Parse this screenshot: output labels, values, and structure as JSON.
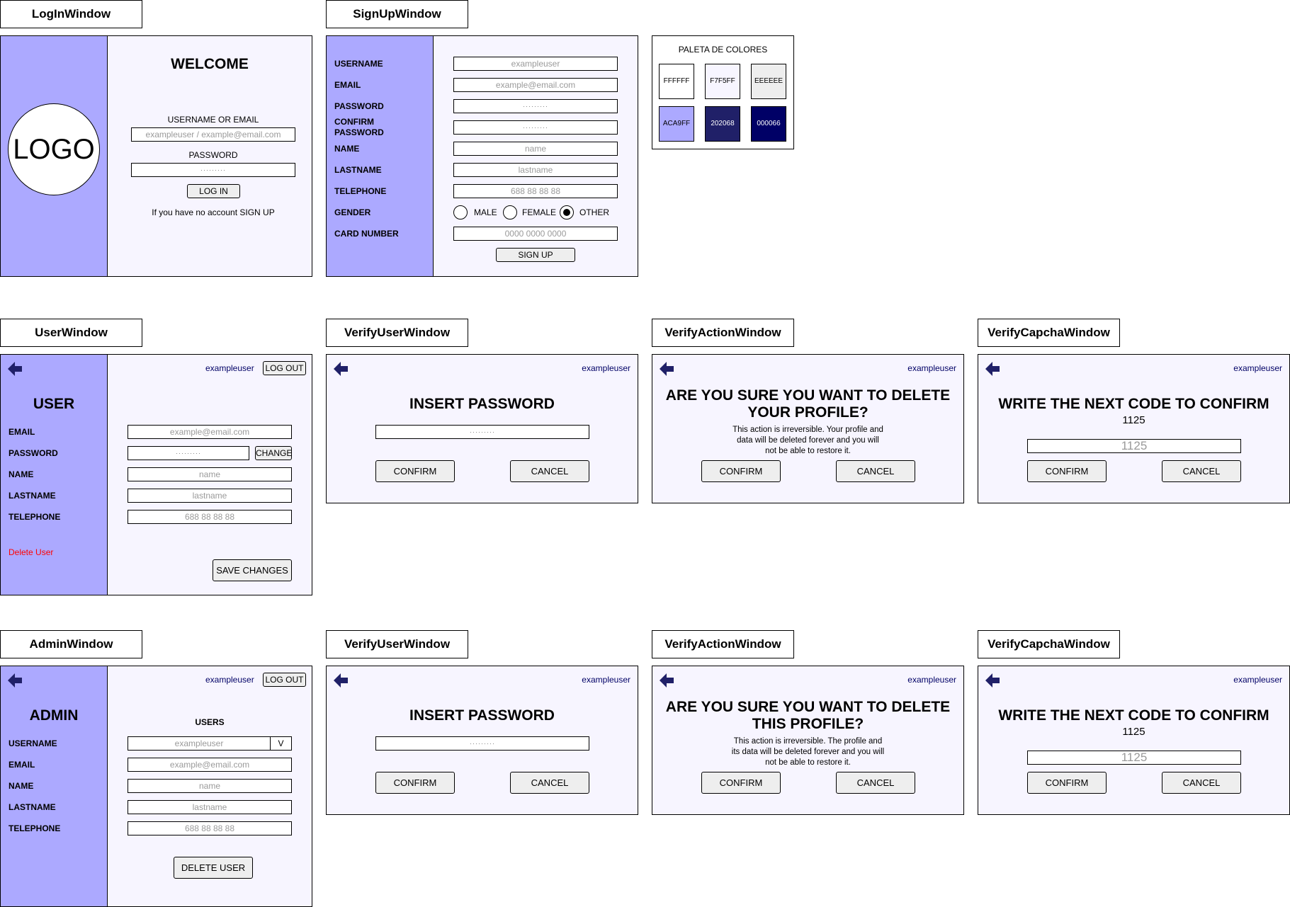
{
  "login": {
    "title": "LogInWindow",
    "logo": "LOGO",
    "heading": "WELCOME",
    "user_label": "USERNAME OR EMAIL",
    "user_placeholder": "exampleuser / example@email.com",
    "pass_label": "PASSWORD",
    "pass_mask": "·········",
    "button": "LOG IN",
    "signup_text": "If you have no account SIGN UP"
  },
  "signup": {
    "title": "SignUpWindow",
    "fields": [
      {
        "label": "USERNAME",
        "value": "exampleuser"
      },
      {
        "label": "EMAIL",
        "value": "example@email.com"
      },
      {
        "label": "PASSWORD",
        "value": "·········"
      },
      {
        "label": "CONFIRM\nPASSWORD",
        "value": "·········"
      },
      {
        "label": "NAME",
        "value": "name"
      },
      {
        "label": "LASTNAME",
        "value": "lastname"
      },
      {
        "label": "TELEPHONE",
        "value": "688 88 88 88"
      },
      {
        "label": "GENDER",
        "value": ""
      },
      {
        "label": "CARD NUMBER",
        "value": "0000 0000 0000"
      }
    ],
    "gender_options": [
      "MALE",
      "FEMALE",
      "OTHER"
    ],
    "gender_selected": "OTHER",
    "button": "SIGN UP"
  },
  "palette": {
    "title": "PALETA DE COLORES",
    "colors": [
      "#FFFFFF",
      "#F7F5FF",
      "#EEEEEE",
      "#ACA9FF",
      "#202068",
      "#000066"
    ],
    "labels": [
      "FFFFFF",
      "F7F5FF",
      "EEEEEE",
      "ACA9FF",
      "202068",
      "000066"
    ]
  },
  "common": {
    "username": "exampleuser",
    "logout": "LOG OUT",
    "confirm": "CONFIRM",
    "cancel": "CANCEL",
    "pass_mask": "·········",
    "code": "1125"
  },
  "user": {
    "title": "UserWindow",
    "heading": "USER",
    "fields": [
      {
        "label": "EMAIL",
        "value": "example@email.com"
      },
      {
        "label": "PASSWORD",
        "value": "·········"
      },
      {
        "label": "NAME",
        "value": "name"
      },
      {
        "label": "LASTNAME",
        "value": "lastname"
      },
      {
        "label": "TELEPHONE",
        "value": "688 88 88 88"
      }
    ],
    "change": "CHANGE",
    "delete": "Delete User",
    "save": "SAVE CHANGES"
  },
  "admin": {
    "title": "AdminWindow",
    "heading": "ADMIN",
    "users_heading": "USERS",
    "fields": [
      {
        "label": "USERNAME",
        "value": "exampleuser"
      },
      {
        "label": "EMAIL",
        "value": "example@email.com"
      },
      {
        "label": "NAME",
        "value": "name"
      },
      {
        "label": "LASTNAME",
        "value": "lastname"
      },
      {
        "label": "TELEPHONE",
        "value": "688 88 88 88"
      }
    ],
    "dropdown": "V",
    "delete": "DELETE USER"
  },
  "verify_user": {
    "title": "VerifyUserWindow",
    "heading": "INSERT PASSWORD"
  },
  "verify_action_1": {
    "title": "VerifyActionWindow",
    "heading": "ARE YOU SURE YOU WANT TO DELETE\nYOUR PROFILE?",
    "text": "This action is irreversible. Your profile and\ndata will be deleted forever and you will\nnot be able to restore it."
  },
  "verify_action_2": {
    "title": "VerifyActionWindow",
    "heading": "ARE YOU SURE YOU WANT TO DELETE\nTHIS PROFILE?",
    "text": "This action is irreversible. The profile and\nits data will be deleted forever and you will\nnot be able to restore it."
  },
  "verify_captcha": {
    "title": "VerifyCapchaWindow",
    "heading": "WRITE THE NEXT CODE TO CONFIRM"
  }
}
